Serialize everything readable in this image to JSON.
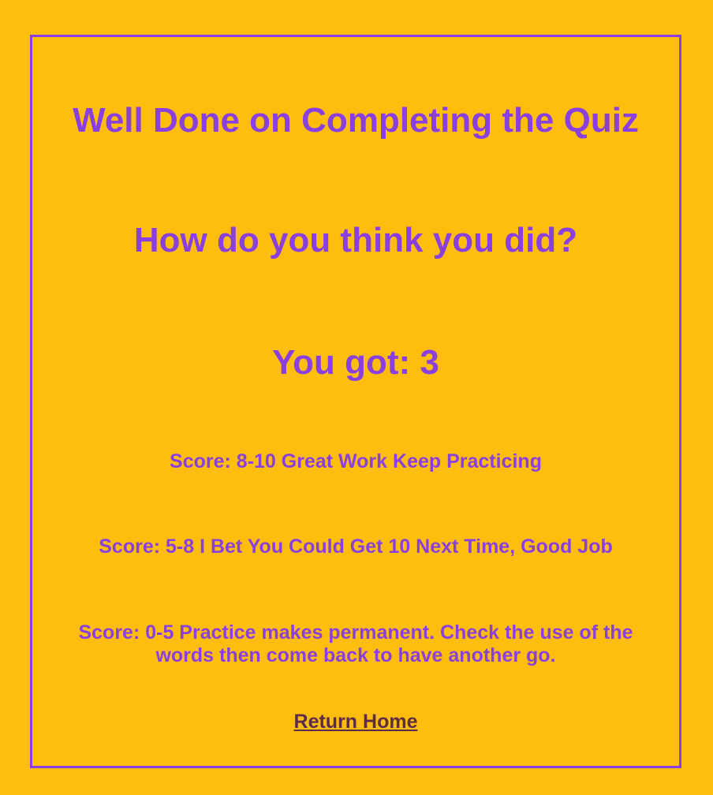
{
  "results": {
    "title": "Well Done on Completing the Quiz",
    "question": "How do you think you did?",
    "score_text": "You got: 3",
    "tiers": [
      "Score: 8-10 Great Work Keep Practicing",
      "Score: 5-8 I Bet You Could Get 10 Next Time, Good Job",
      "Score: 0-5 Practice makes permanent. Check the use of the words then come back to have another go."
    ],
    "return_link": "Return Home"
  },
  "colors": {
    "background": "#FFBD0D",
    "accent": "#8A3FE0",
    "link": "#5C2B4A"
  }
}
